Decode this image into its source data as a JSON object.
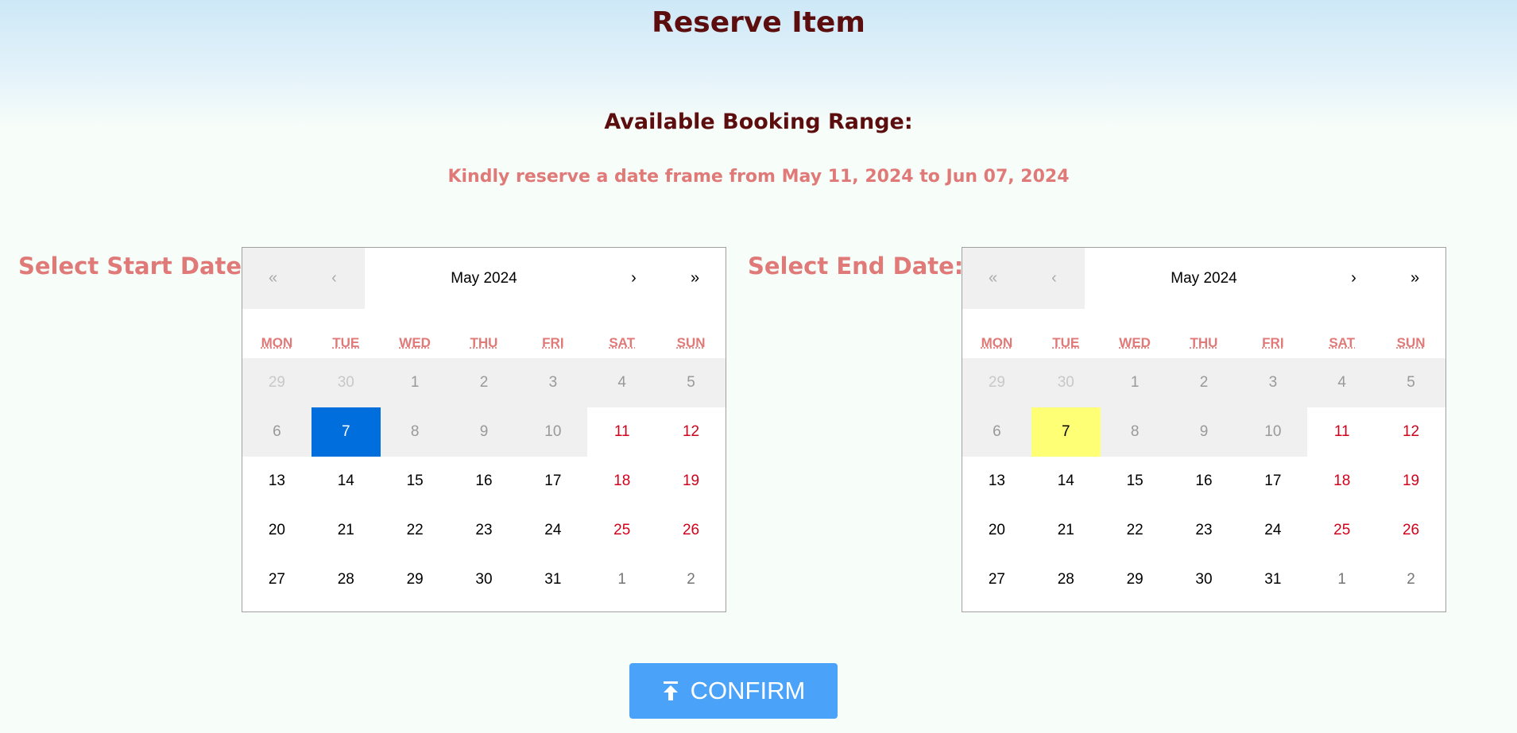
{
  "page": {
    "title": "Reserve Item",
    "range_heading": "Available Booking Range:",
    "range_text": "Kindly reserve a date frame from May 11, 2024 to Jun 07, 2024"
  },
  "colors": {
    "title": "#5c0d0d",
    "accent": "#e07a78",
    "selected_day": "#006edc",
    "today_day": "#ffff76",
    "weekend_day": "#d0021b",
    "confirm_button": "#4aa3f8"
  },
  "weekdays": [
    "MON",
    "TUE",
    "WED",
    "THU",
    "FRI",
    "SAT",
    "SUN"
  ],
  "start_calendar": {
    "label": "Select Start Date:",
    "nav": {
      "prev_year": "«",
      "prev_month": "‹",
      "month_label": "May 2024",
      "next_month": "›",
      "next_year": "»"
    },
    "days": [
      {
        "d": "29",
        "s": "disabled neighbor"
      },
      {
        "d": "30",
        "s": "disabled neighbor"
      },
      {
        "d": "1",
        "s": "disabled"
      },
      {
        "d": "2",
        "s": "disabled"
      },
      {
        "d": "3",
        "s": "disabled"
      },
      {
        "d": "4",
        "s": "disabled"
      },
      {
        "d": "5",
        "s": "disabled"
      },
      {
        "d": "6",
        "s": "disabled"
      },
      {
        "d": "7",
        "s": "selected"
      },
      {
        "d": "8",
        "s": "disabled"
      },
      {
        "d": "9",
        "s": "disabled"
      },
      {
        "d": "10",
        "s": "disabled"
      },
      {
        "d": "11",
        "s": "weekend"
      },
      {
        "d": "12",
        "s": "weekend"
      },
      {
        "d": "13",
        "s": ""
      },
      {
        "d": "14",
        "s": ""
      },
      {
        "d": "15",
        "s": ""
      },
      {
        "d": "16",
        "s": ""
      },
      {
        "d": "17",
        "s": ""
      },
      {
        "d": "18",
        "s": "weekend"
      },
      {
        "d": "19",
        "s": "weekend"
      },
      {
        "d": "20",
        "s": ""
      },
      {
        "d": "21",
        "s": ""
      },
      {
        "d": "22",
        "s": ""
      },
      {
        "d": "23",
        "s": ""
      },
      {
        "d": "24",
        "s": ""
      },
      {
        "d": "25",
        "s": "weekend"
      },
      {
        "d": "26",
        "s": "weekend"
      },
      {
        "d": "27",
        "s": ""
      },
      {
        "d": "28",
        "s": ""
      },
      {
        "d": "29",
        "s": ""
      },
      {
        "d": "30",
        "s": ""
      },
      {
        "d": "31",
        "s": ""
      },
      {
        "d": "1",
        "s": "neighbor-next"
      },
      {
        "d": "2",
        "s": "neighbor-next"
      }
    ]
  },
  "end_calendar": {
    "label": "Select End Date:",
    "nav": {
      "prev_year": "«",
      "prev_month": "‹",
      "month_label": "May 2024",
      "next_month": "›",
      "next_year": "»"
    },
    "days": [
      {
        "d": "29",
        "s": "disabled neighbor"
      },
      {
        "d": "30",
        "s": "disabled neighbor"
      },
      {
        "d": "1",
        "s": "disabled"
      },
      {
        "d": "2",
        "s": "disabled"
      },
      {
        "d": "3",
        "s": "disabled"
      },
      {
        "d": "4",
        "s": "disabled"
      },
      {
        "d": "5",
        "s": "disabled"
      },
      {
        "d": "6",
        "s": "disabled"
      },
      {
        "d": "7",
        "s": "today"
      },
      {
        "d": "8",
        "s": "disabled"
      },
      {
        "d": "9",
        "s": "disabled"
      },
      {
        "d": "10",
        "s": "disabled"
      },
      {
        "d": "11",
        "s": "weekend"
      },
      {
        "d": "12",
        "s": "weekend"
      },
      {
        "d": "13",
        "s": ""
      },
      {
        "d": "14",
        "s": ""
      },
      {
        "d": "15",
        "s": ""
      },
      {
        "d": "16",
        "s": ""
      },
      {
        "d": "17",
        "s": ""
      },
      {
        "d": "18",
        "s": "weekend"
      },
      {
        "d": "19",
        "s": "weekend"
      },
      {
        "d": "20",
        "s": ""
      },
      {
        "d": "21",
        "s": ""
      },
      {
        "d": "22",
        "s": ""
      },
      {
        "d": "23",
        "s": ""
      },
      {
        "d": "24",
        "s": ""
      },
      {
        "d": "25",
        "s": "weekend"
      },
      {
        "d": "26",
        "s": "weekend"
      },
      {
        "d": "27",
        "s": ""
      },
      {
        "d": "28",
        "s": ""
      },
      {
        "d": "29",
        "s": ""
      },
      {
        "d": "30",
        "s": ""
      },
      {
        "d": "31",
        "s": ""
      },
      {
        "d": "1",
        "s": "neighbor-next"
      },
      {
        "d": "2",
        "s": "neighbor-next"
      }
    ]
  },
  "confirm": {
    "label": "CONFIRM",
    "icon": "upload-icon"
  }
}
